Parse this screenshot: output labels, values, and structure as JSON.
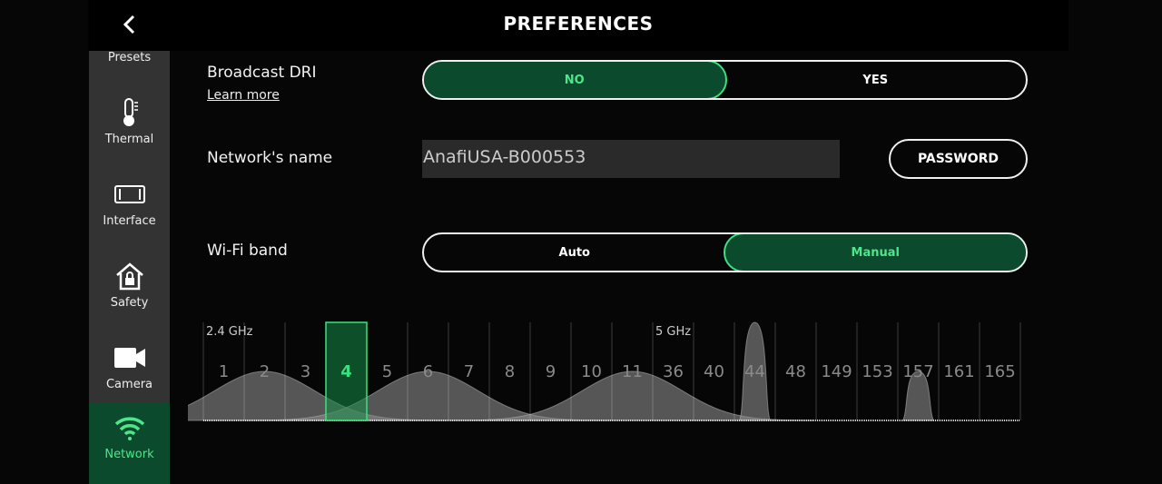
{
  "header": {
    "title": "PREFERENCES",
    "back_icon": "chevron-left-icon"
  },
  "sidebar": {
    "items": [
      {
        "label": "Presets",
        "icon": "presets-icon"
      },
      {
        "label": "Thermal",
        "icon": "thermometer-icon"
      },
      {
        "label": "Interface",
        "icon": "interface-icon"
      },
      {
        "label": "Safety",
        "icon": "house-lock-icon"
      },
      {
        "label": "Camera",
        "icon": "video-camera-icon"
      },
      {
        "label": "Network",
        "icon": "wifi-icon",
        "active": true
      }
    ]
  },
  "broadcast": {
    "label": "Broadcast DRI",
    "learn_more": "Learn more",
    "options": [
      "NO",
      "YES"
    ],
    "selected": "NO"
  },
  "network": {
    "label": "Network's name",
    "value": "AnafiUSA-B000553",
    "password_button": "PASSWORD"
  },
  "wifi_band": {
    "label": "Wi-Fi band",
    "options": [
      "Auto",
      "Manual"
    ],
    "selected": "Manual"
  },
  "channels": {
    "band_labels": [
      "2.4 GHz",
      "5 GHz"
    ],
    "list": [
      "1",
      "2",
      "3",
      "4",
      "5",
      "6",
      "7",
      "8",
      "9",
      "10",
      "11",
      "36",
      "40",
      "44",
      "48",
      "149",
      "153",
      "157",
      "161",
      "165"
    ],
    "selected": "4",
    "accent": "#3de07f",
    "interference": [
      {
        "channel": "2",
        "level": 0.5,
        "width": "wide"
      },
      {
        "channel": "6",
        "level": 0.5,
        "width": "wide"
      },
      {
        "channel": "11",
        "level": 0.5,
        "width": "wide"
      },
      {
        "channel": "44",
        "level": 1.0,
        "width": "narrow"
      },
      {
        "channel": "157",
        "level": 0.5,
        "width": "narrow"
      }
    ]
  }
}
